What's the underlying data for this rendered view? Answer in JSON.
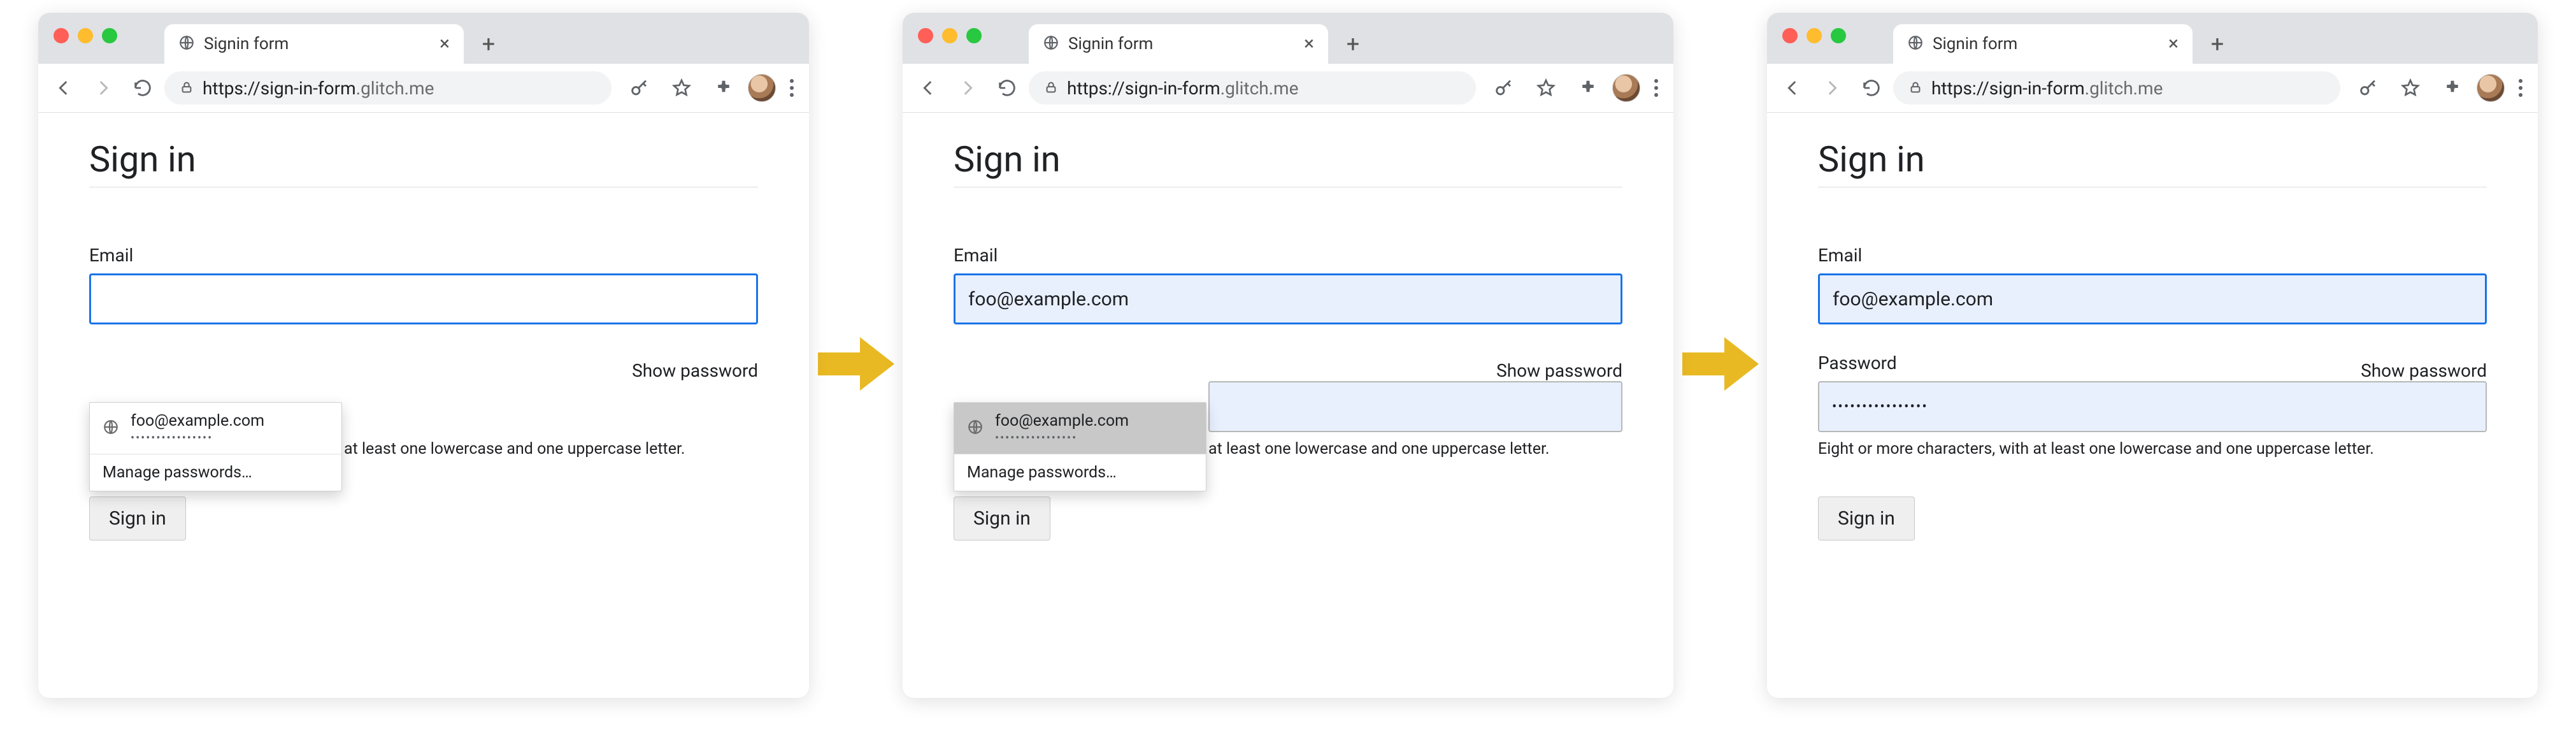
{
  "browser": {
    "tab_title": "Signin form",
    "url_origin": "https://sign-in-form",
    "url_path": ".glitch.me"
  },
  "page": {
    "heading": "Sign in",
    "email_label": "Email",
    "password_label": "Password",
    "show_password": "Show password",
    "password_hint": "Eight or more characters, with at least one lowercase and one uppercase letter.",
    "signin_button": "Sign in"
  },
  "autofill": {
    "suggestion_user": "foo@example.com",
    "suggestion_pass_mask": "••••••••••••••••",
    "manage_label": "Manage passwords…"
  },
  "states": {
    "s1": {
      "email_value": "",
      "password_value": "",
      "dropdown_highlight": false
    },
    "s2": {
      "email_value": "foo@example.com",
      "password_value": "••••••••••••••••",
      "dropdown_highlight": true
    },
    "s3": {
      "email_value": "foo@example.com",
      "password_value": "••••••••••••••••"
    }
  }
}
